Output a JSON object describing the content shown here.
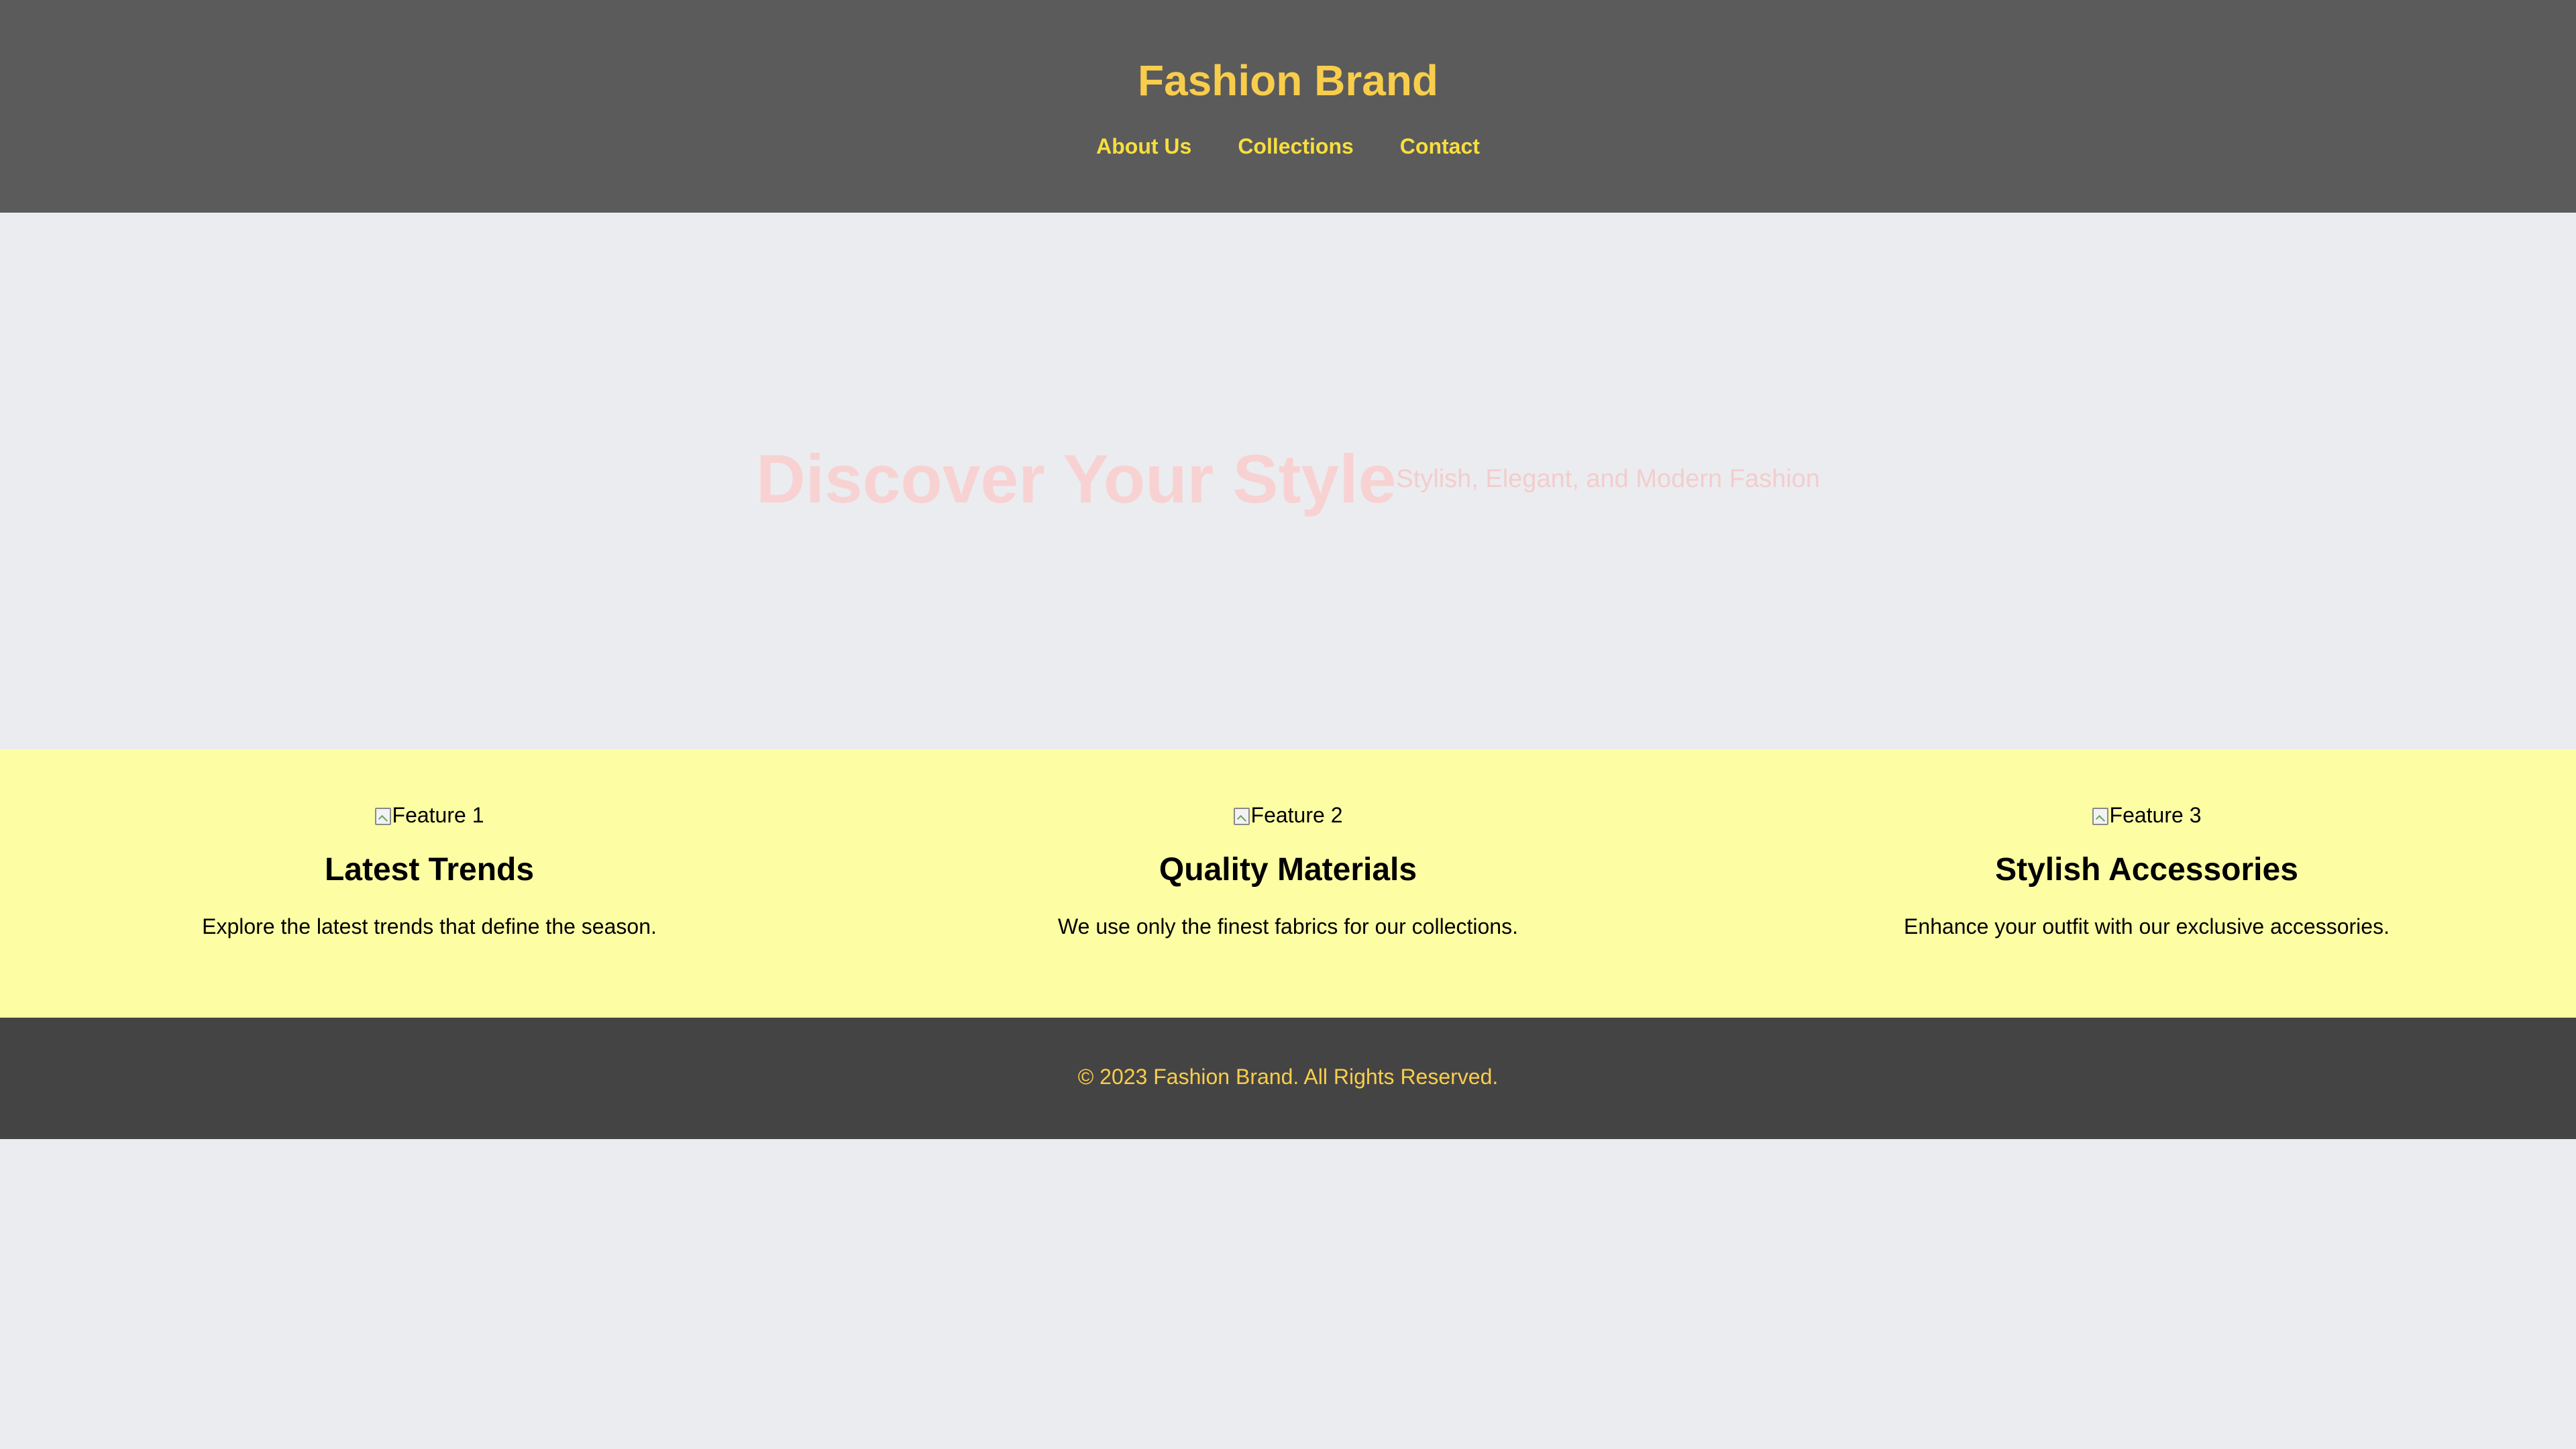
{
  "header": {
    "brand": "Fashion Brand",
    "nav": [
      {
        "label": "About Us"
      },
      {
        "label": "Collections"
      },
      {
        "label": "Contact"
      }
    ]
  },
  "hero": {
    "title": "Discover Your Style",
    "subtitle": "Stylish, Elegant, and Modern Fashion"
  },
  "features": [
    {
      "image_alt": "Feature 1",
      "title": "Latest Trends",
      "text": "Explore the latest trends that define the season."
    },
    {
      "image_alt": "Feature 2",
      "title": "Quality Materials",
      "text": "We use only the finest fabrics for our collections."
    },
    {
      "image_alt": "Feature 3",
      "title": "Stylish Accessories",
      "text": "Enhance your outfit with our exclusive accessories."
    }
  ],
  "footer": {
    "text": "© 2023 Fashion Brand. All Rights Reserved."
  },
  "colors": {
    "header_bg": "#5b5b5b",
    "brand": "#f9cd4c",
    "nav_link": "#f7de3e",
    "page_bg": "#ebecef",
    "hero_text": "#f8d2d2",
    "features_bg": "#fdfea4",
    "footer_bg": "#444444"
  }
}
